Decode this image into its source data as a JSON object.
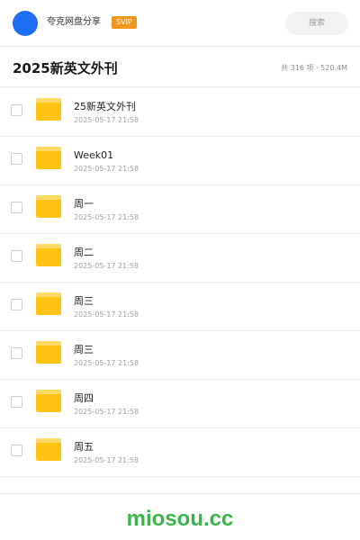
{
  "header": {
    "brand": "夸克网盘分享",
    "badge": "SVIP",
    "search_label": "搜索",
    "accent": "#1f6cf5",
    "badge_color": "#f2961e"
  },
  "folder": {
    "title": "2025新英文外刊",
    "stats": "共 316 项 · 520.4M"
  },
  "files": [
    {
      "name": "25新英文外刊",
      "date": "2025-05-17 21:58",
      "icon": "folder-icon"
    },
    {
      "name": "Week01",
      "date": "2025-05-17 21:58",
      "icon": "folder-icon"
    },
    {
      "name": "周一",
      "date": "2025-05-17 21:58",
      "icon": "folder-icon"
    },
    {
      "name": "周二",
      "date": "2025-05-17 21:58",
      "icon": "folder-icon"
    },
    {
      "name": "周三",
      "date": "2025-05-17 21:58",
      "icon": "folder-icon"
    },
    {
      "name": "周三",
      "date": "2025-05-17 21:58",
      "icon": "folder-icon"
    },
    {
      "name": "周四",
      "date": "2025-05-17 21:58",
      "icon": "folder-icon"
    },
    {
      "name": "周五",
      "date": "2025-05-17 21:58",
      "icon": "folder-icon"
    }
  ],
  "footer": {
    "watermark": "miosou.cc",
    "watermark_color": "#3ab54a"
  }
}
